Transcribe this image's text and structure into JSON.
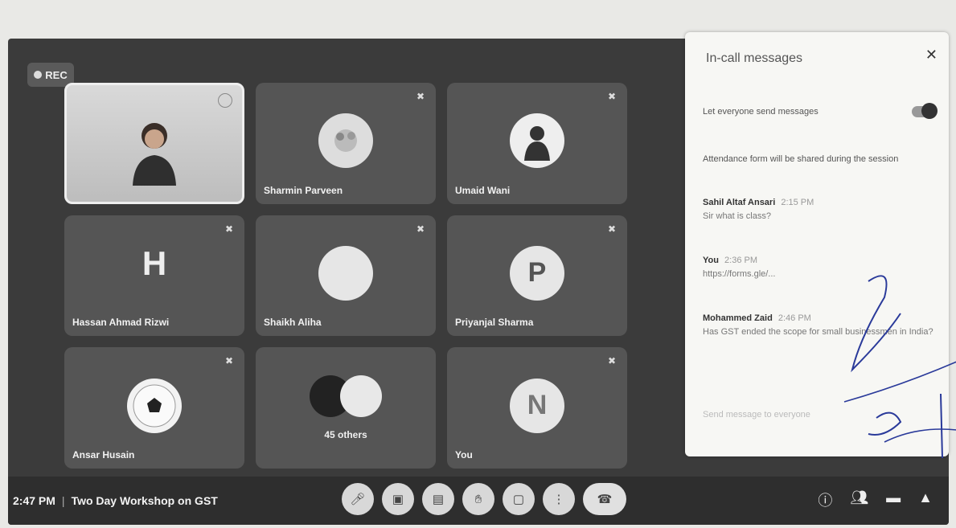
{
  "recording": {
    "label": "REC"
  },
  "tiles": [
    {
      "name": "",
      "type": "video"
    },
    {
      "name": "Sharmin Parveen",
      "type": "avatar-photo"
    },
    {
      "name": "Umaid Wani",
      "type": "avatar-photo"
    },
    {
      "name": "Hassan Ahmad Rizwi",
      "type": "letter",
      "letter": "H"
    },
    {
      "name": "Shaikh Aliha",
      "type": "avatar-blank"
    },
    {
      "name": "Priyanjal Sharma",
      "type": "avatar-letter",
      "letter": "P"
    },
    {
      "name": "Ansar Husain",
      "type": "avatar-ball"
    },
    {
      "name": "",
      "type": "others",
      "others_label": "45 others"
    },
    {
      "name": "You",
      "type": "avatar-letter",
      "letter": "N"
    }
  ],
  "meeting": {
    "time": "2:47 PM",
    "separator": "|",
    "title": "Two Day Workshop on GST"
  },
  "chat": {
    "title": "In-call messages",
    "toggle_label": "Let everyone send messages",
    "toggle_on": true,
    "note": "Attendance form will be shared during the session",
    "messages": [
      {
        "author": "Sahil Altaf Ansari",
        "time": "2:15 PM",
        "text": "Sir what is class?"
      },
      {
        "author": "You",
        "time": "2:36 PM",
        "text": "https://forms.gle/..."
      },
      {
        "author": "Mohammed Zaid",
        "time": "2:46 PM",
        "text": "Has GST ended the scope for small businessmen in India?"
      }
    ],
    "input_placeholder": "Send message to everyone"
  },
  "icons": {
    "controls": [
      "mic-icon",
      "camera-icon",
      "captions-icon",
      "raise-hand-icon",
      "present-icon",
      "more-icon",
      "end-call-icon"
    ],
    "right": [
      "info-icon",
      "people-icon",
      "chat-icon",
      "activities-icon"
    ]
  }
}
